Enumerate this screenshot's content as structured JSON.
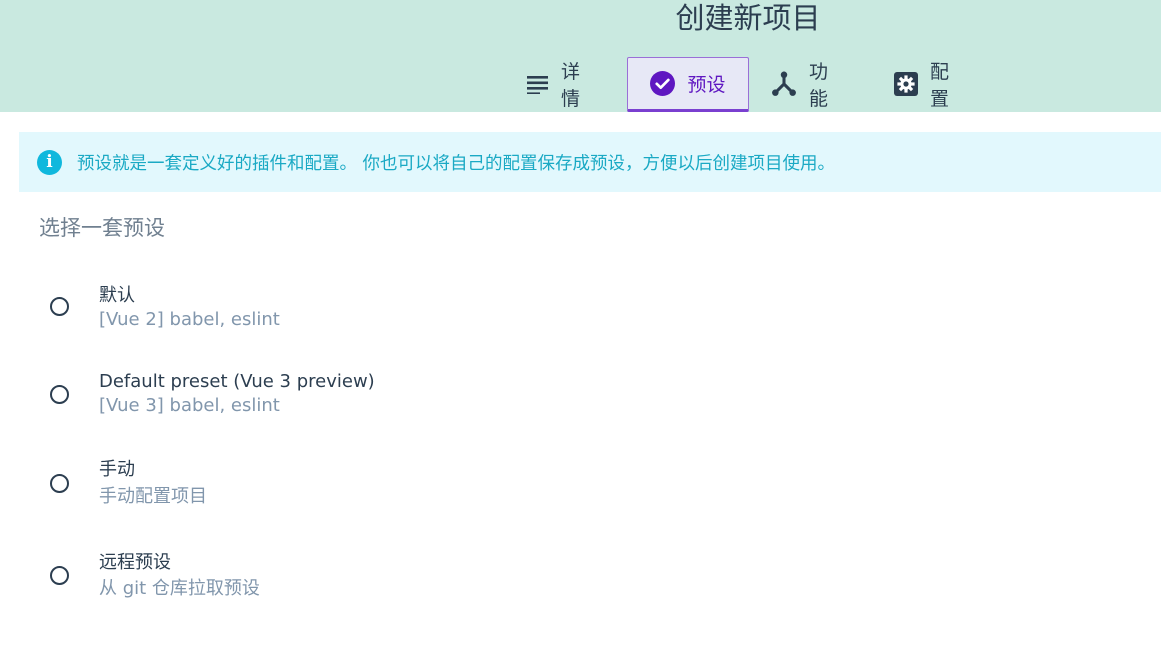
{
  "header": {
    "title": "创建新项目",
    "tabs": [
      {
        "label": "详情",
        "icon": "list-icon",
        "active": false
      },
      {
        "label": "预设",
        "icon": "check-circle-icon",
        "active": true
      },
      {
        "label": "功能",
        "icon": "merge-icon",
        "active": false
      },
      {
        "label": "配置",
        "icon": "gear-icon",
        "active": false
      }
    ]
  },
  "info": {
    "icon": "info-icon",
    "text": "预设就是一套定义好的插件和配置。 你也可以将自己的配置保存成预设，方便以后创建项目使用。"
  },
  "presets": {
    "title": "选择一套预设",
    "options": [
      {
        "name": "默认",
        "description": "[Vue 2] babel, eslint",
        "selected": false
      },
      {
        "name": "Default preset (Vue 3 preview)",
        "description": "[Vue 3] babel, eslint",
        "selected": false
      },
      {
        "name": "手动",
        "description": "手动配置项目",
        "selected": false
      },
      {
        "name": "远程预设",
        "description": "从 git 仓库拉取预设",
        "selected": false
      }
    ]
  },
  "colors": {
    "header_bg": "#c9e9e0",
    "accent": "#7a3fd0",
    "info_bg": "#e2f8fd",
    "info_text": "#1aa9c4",
    "text": "#2c3e50",
    "muted": "#8196ac"
  }
}
